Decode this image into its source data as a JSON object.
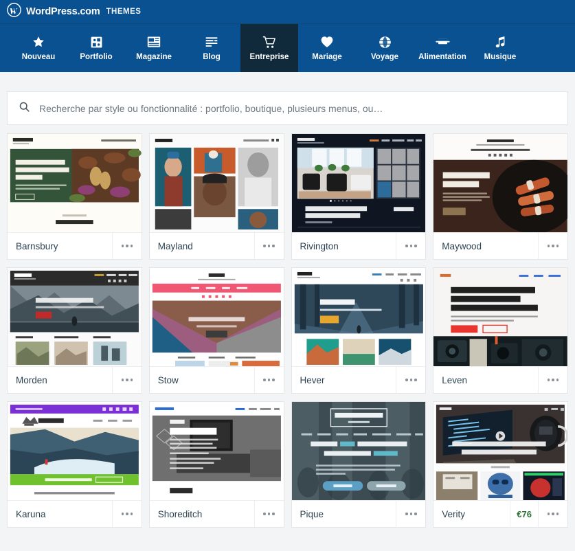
{
  "masthead": {
    "logo_icon": "wordpress-logo-icon",
    "brand": "WordPress.com",
    "section": "THEMES"
  },
  "nav": {
    "items": [
      {
        "label": "Nouveau",
        "icon": "star-icon",
        "active": false
      },
      {
        "label": "Portfolio",
        "icon": "grid-squares-icon",
        "active": false
      },
      {
        "label": "Magazine",
        "icon": "layout-icon",
        "active": false
      },
      {
        "label": "Blog",
        "icon": "text-lines-icon",
        "active": false
      },
      {
        "label": "Entreprise",
        "icon": "cart-icon",
        "active": true
      },
      {
        "label": "Mariage",
        "icon": "heart-icon",
        "active": false
      },
      {
        "label": "Voyage",
        "icon": "globe-icon",
        "active": false
      },
      {
        "label": "Alimentation",
        "icon": "tray-icon",
        "active": false
      },
      {
        "label": "Musique",
        "icon": "music-note-icon",
        "active": false
      }
    ]
  },
  "search": {
    "icon": "search-icon",
    "value": "",
    "placeholder": "Recherche par style ou fonctionnalité : portfolio, boutique, plusieurs menus, ou…"
  },
  "colors": {
    "nav_blue": "#0a5191",
    "nav_active": "#102a3c",
    "page_background": "#f3f4f5",
    "card_background": "#ffffff",
    "price_green": "#2c7337",
    "title_text": "#2e4453"
  },
  "themes": [
    {
      "name": "Barnsbury",
      "price": "",
      "more_label": "•••",
      "preview": {
        "style": "barnsbury",
        "headline": "Locally Farmed Organic Vegetable Delivery",
        "site_title": "Barnsbury",
        "menu": [
          "Home",
          "About",
          "Blog",
          "Contact"
        ],
        "cta": "Get In Touch"
      }
    },
    {
      "name": "Mayland",
      "price": "",
      "more_label": "•••",
      "preview": {
        "style": "mayland",
        "headline": "",
        "site_title": "Mayland",
        "menu": [
          "Home",
          "About",
          "Contact"
        ],
        "cta": ""
      }
    },
    {
      "name": "Rivington",
      "price": "",
      "more_label": "•••",
      "preview": {
        "style": "rivington",
        "headline": "Award-Winning Modern Mediterranean Style House",
        "site_title": "Rivington",
        "menu": [
          "Home",
          "About",
          "Services",
          "Blog",
          "Contact"
        ],
        "cta": "$700,000"
      }
    },
    {
      "name": "Maywood",
      "price": "",
      "more_label": "•••",
      "preview": {
        "style": "maywood",
        "headline": "Enjoy Our Food Experience",
        "site_title": "MAYWOOD",
        "menu": [
          "Home",
          "Menu",
          "What's On",
          "Reservations"
        ],
        "cta": "Read More"
      }
    },
    {
      "name": "Morden",
      "price": "",
      "more_label": "•••",
      "preview": {
        "style": "morden",
        "headline": "Morden Mountain Movers",
        "site_title": "Morden",
        "menu": [
          "Home",
          "About",
          "News",
          "Contact"
        ],
        "cta": "About"
      }
    },
    {
      "name": "Stow",
      "price": "",
      "more_label": "•••",
      "preview": {
        "style": "stow",
        "headline": "Welcome to Stow Stationery",
        "site_title": "STOW",
        "menu": [
          "Shop",
          "Blog",
          "About",
          "Contact"
        ],
        "cta": "Subscribe"
      }
    },
    {
      "name": "Hever",
      "price": "",
      "more_label": "•••",
      "preview": {
        "style": "hever",
        "headline": "Hever Travel",
        "site_title": "Hever",
        "menu": [
          "Home",
          "News",
          "About",
          "Contact"
        ],
        "cta": "More"
      }
    },
    {
      "name": "Leven",
      "price": "",
      "more_label": "•••",
      "preview": {
        "style": "leven",
        "headline": "A Curated Collection of Refurbished Vintage Cameras & Accessories.",
        "site_title": "Leven",
        "menu": [
          "Home",
          "About",
          "Contact"
        ],
        "cta": "Shop now"
      }
    },
    {
      "name": "Karuna",
      "price": "",
      "more_label": "•••",
      "preview": {
        "style": "karuna",
        "headline": "Welcome to Karuna Yoga: Compassionate education and practice",
        "site_title": "KARUNA",
        "menu": [
          "Home",
          "About",
          "Join",
          "Contact"
        ],
        "cta": "Sign up now"
      }
    },
    {
      "name": "Shoreditch",
      "price": "",
      "more_label": "•••",
      "preview": {
        "style": "shoreditch",
        "headline": "Welcome",
        "site_title": "Shoreditch",
        "menu": [
          "Home",
          "News",
          "About us",
          "Contact us"
        ],
        "cta": "Partners"
      }
    },
    {
      "name": "Pique",
      "price": "",
      "more_label": "•••",
      "preview": {
        "style": "pique",
        "headline": "If your cafe is your bread and butter, Pique is going to be your jam.",
        "site_title": "PIQUE CAFE",
        "menu": [
          "About",
          "Applique",
          "Headroom",
          "What's New",
          "Lunch Club Specials",
          "Best Selections",
          "Find Us"
        ],
        "cta": "Learn the menu"
      }
    },
    {
      "name": "Verity",
      "price": "€76",
      "more_label": "•••",
      "preview": {
        "style": "verity",
        "headline": "Donec euismod quis dapibus dui tempor vestibulum. Proin elementum leo",
        "site_title": "Verity",
        "menu": [
          "Home"
        ],
        "cta": ""
      }
    }
  ]
}
